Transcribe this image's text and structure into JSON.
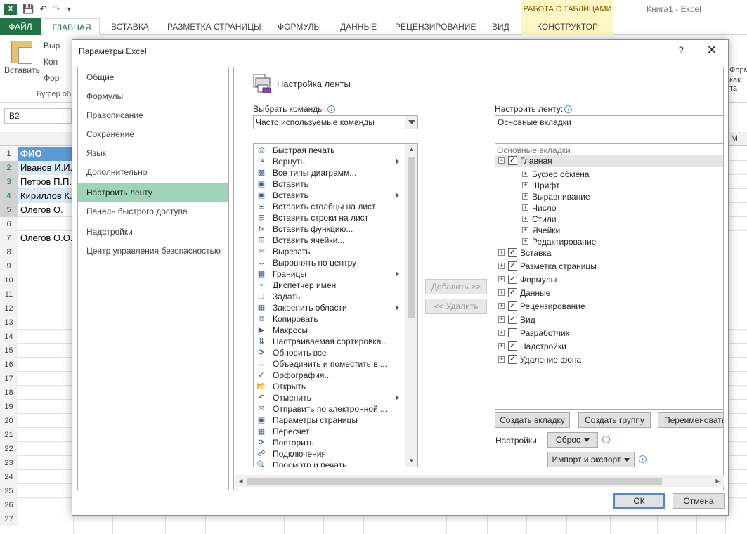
{
  "excel": {
    "window_title": "Книга1 - Excel",
    "context_header": "РАБОТА С ТАБЛИЦАМИ",
    "tabs": [
      "ФАЙЛ",
      "ГЛАВНАЯ",
      "ВСТАВКА",
      "РАЗМЕТКА СТРАНИЦЫ",
      "ФОРМУЛЫ",
      "ДАННЫЕ",
      "РЕЦЕНЗИРОВАНИЕ",
      "ВИД",
      "КОНСТРУКТОР"
    ],
    "paste_label": "Вставить",
    "clipboard_cmds": [
      "Выр",
      "Коп",
      "Фор"
    ],
    "clipboard_group": "Буфер об",
    "right_fragments": [
      "Формат",
      "как та"
    ],
    "namebox": "B2",
    "col_m": "M",
    "rows": [
      "1",
      "2",
      "3",
      "4",
      "5",
      "6",
      "7",
      "8",
      "9",
      "10",
      "11",
      "12",
      "13",
      "14",
      "15",
      "16",
      "17",
      "18",
      "19",
      "20",
      "21",
      "22",
      "23",
      "24",
      "25",
      "26",
      "27"
    ],
    "cells": {
      "r1": "ФИО",
      "r2": "Иванов И.И.",
      "r3": "Петров П.П.",
      "r4": "Кириллов К.",
      "r5": "Олегов    О.",
      "r7": "Олегов О.О."
    }
  },
  "dialog": {
    "title": "Параметры Excel",
    "help": "?",
    "close": "✕",
    "nav": [
      "Общие",
      "Формулы",
      "Правописание",
      "Сохранение",
      "Язык",
      "Дополнительно",
      "Настроить ленту",
      "Панель быстрого доступа",
      "Надстройки",
      "Центр управления безопасностью"
    ],
    "section_title": "Настройка ленты",
    "choose_label": "Выбрать команды:",
    "choose_value": "Часто используемые команды",
    "customize_label": "Настроить ленту:",
    "customize_value": "Основные вкладки",
    "commands": [
      "Быстрая печать",
      "Вернуть",
      "Все типы диаграмм...",
      "Вставить",
      "Вставить",
      "Вставить столбцы на лист",
      "Вставить строки на лист",
      "Вставить функцию...",
      "Вставить ячейки...",
      "Вырезать",
      "Выровнять по центру",
      "Границы",
      "Диспетчер имен",
      "Задать",
      "Закрепить области",
      "Копировать",
      "Макросы",
      "Настраиваемая сортировка...",
      "Обновить все",
      "Объединить и поместить в ...",
      "Орфография...",
      "Открыть",
      "Отменить",
      "Отправить по электронной ...",
      "Параметры страницы",
      "Пересчет",
      "Повторить",
      "Подключения",
      "Просмотр и печать"
    ],
    "add_button": "Добавить >>",
    "remove_button": "<< Удалить",
    "tree_header": "Основные вкладки",
    "tree_main": "Главная",
    "tree_main_groups": [
      "Буфер обмена",
      "Шрифт",
      "Выравнивание",
      "Число",
      "Стили",
      "Ячейки",
      "Редактирование"
    ],
    "tree_tabs": [
      "Вставка",
      "Разметка страницы",
      "Формулы",
      "Данные",
      "Рецензирование",
      "Вид",
      "Разработчик",
      "Надстройки",
      "Удаление фона"
    ],
    "new_tab_button": "Создать вкладку",
    "new_group_button": "Создать группу",
    "rename_button": "Переименовать...",
    "settings_label": "Настройки:",
    "reset_button": "Сброс",
    "import_export_button": "Импорт и экспорт",
    "ok_button": "ОК",
    "cancel_button": "Отмена"
  }
}
